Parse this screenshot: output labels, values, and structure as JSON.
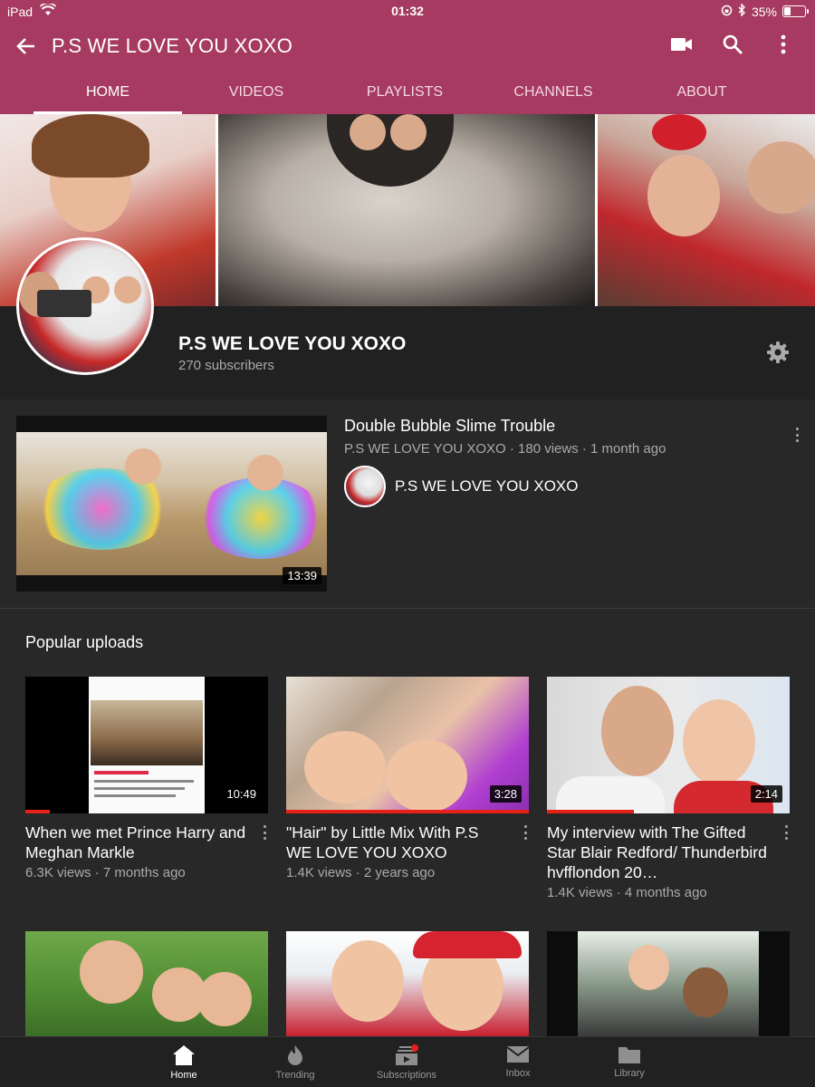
{
  "status_bar": {
    "device": "iPad",
    "time": "01:32",
    "battery": "35%",
    "battery_level": 0.35
  },
  "app_bar": {
    "title": "P.S WE LOVE YOU XOXO",
    "icons": [
      "back-arrow-icon",
      "video-camera-icon",
      "search-icon",
      "more-vert-icon"
    ]
  },
  "tabs": [
    {
      "label": "HOME",
      "active": true
    },
    {
      "label": "VIDEOS",
      "active": false
    },
    {
      "label": "PLAYLISTS",
      "active": false
    },
    {
      "label": "CHANNELS",
      "active": false
    },
    {
      "label": "ABOUT",
      "active": false
    }
  ],
  "channel": {
    "name": "P.S WE LOVE YOU XOXO",
    "subscribers": "270 subscribers"
  },
  "featured": {
    "title": "Double Bubble  Slime Trouble",
    "meta": "P.S WE LOVE YOU XOXO · 180 views · 1 month ago",
    "owner": "P.S WE LOVE YOU XOXO",
    "duration": "13:39"
  },
  "popular": {
    "heading": "Popular uploads",
    "videos": [
      {
        "title": "When we met Prince Harry and Meghan Markle",
        "meta": "6.3K views · 7 months ago",
        "duration": "10:49",
        "watched": 0.1
      },
      {
        "title": "\"Hair\" by Little Mix With P.S WE LOVE YOU XOXO",
        "meta": "1.4K views · 2 years ago",
        "duration": "3:28",
        "watched": 1.0
      },
      {
        "title": "My interview with The Gifted Star Blair Redford/ Thunderbird hvfflondon 20…",
        "meta": "1.4K views · 4 months ago",
        "duration": "2:14",
        "watched": 0.36
      }
    ]
  },
  "bottom_nav": [
    {
      "label": "Home",
      "icon": "home-icon",
      "active": true
    },
    {
      "label": "Trending",
      "icon": "flame-icon",
      "active": false
    },
    {
      "label": "Subscriptions",
      "icon": "subscriptions-icon",
      "active": false
    },
    {
      "label": "Inbox",
      "icon": "mail-icon",
      "active": false
    },
    {
      "label": "Library",
      "icon": "folder-icon",
      "active": false
    }
  ],
  "colors": {
    "brand": "#a63a60",
    "background": "#282828",
    "progress": "#e62117"
  }
}
